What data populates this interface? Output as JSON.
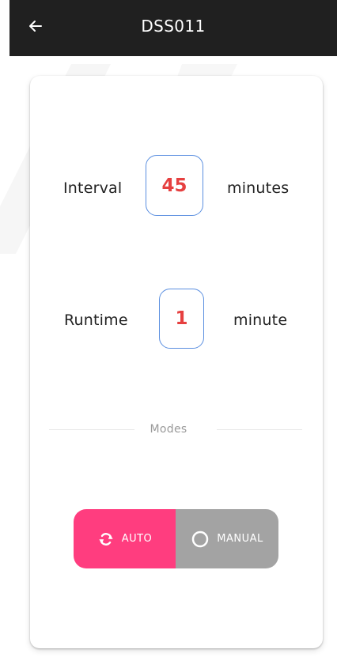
{
  "header": {
    "title": "DSS011",
    "back_icon": "arrow-left-icon"
  },
  "settings": {
    "interval": {
      "label": "Interval",
      "value": "45",
      "unit": "minutes"
    },
    "runtime": {
      "label": "Runtime",
      "value": "1",
      "unit": "minute"
    }
  },
  "modes": {
    "section_label": "Modes",
    "selected": "auto",
    "auto": {
      "label": "AUTO",
      "icon": "refresh-icon",
      "color": "#ff3d7f"
    },
    "manual": {
      "label": "MANUAL",
      "icon": "circle-icon",
      "color": "#a3a3a3"
    }
  },
  "colors": {
    "value_text": "#e64040",
    "value_border": "#5b8fe0",
    "header_bg": "#202020"
  }
}
